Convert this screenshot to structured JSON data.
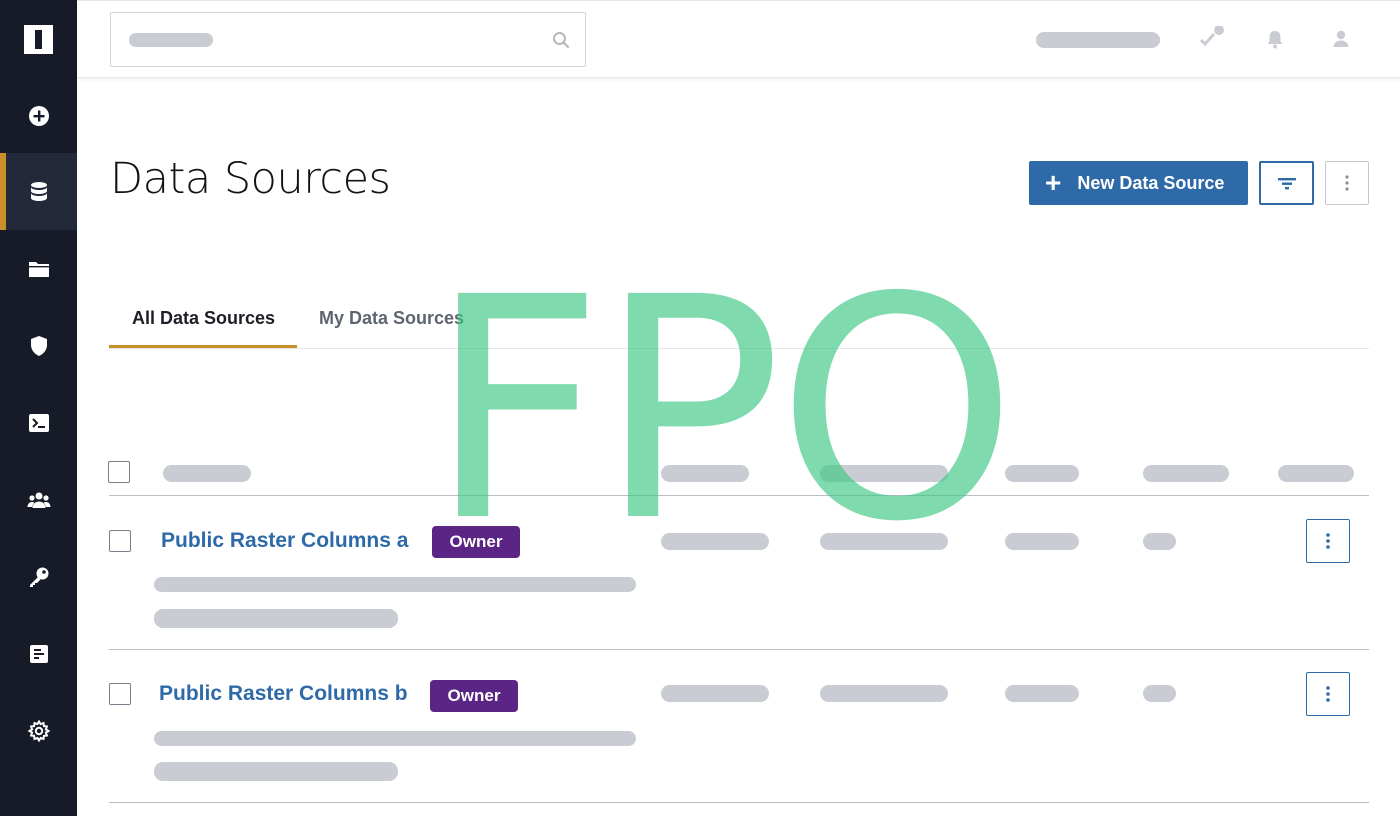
{
  "sidebar": {
    "logo": "app-logo",
    "items": [
      {
        "icon": "plus-circle-icon",
        "active": false
      },
      {
        "icon": "database-icon",
        "active": true
      },
      {
        "icon": "folder-icon",
        "active": false
      },
      {
        "icon": "shield-icon",
        "active": false
      },
      {
        "icon": "terminal-icon",
        "active": false
      },
      {
        "icon": "users-icon",
        "active": false
      },
      {
        "icon": "key-icon",
        "active": false
      },
      {
        "icon": "report-icon",
        "active": false
      },
      {
        "icon": "gear-icon",
        "active": false
      }
    ]
  },
  "header": {
    "search": {
      "placeholder": "",
      "icon": "search-icon"
    },
    "icons": [
      "tasks-icon",
      "bell-icon",
      "user-icon"
    ]
  },
  "page": {
    "title": "Data Sources",
    "new_button_label": "New Data Source",
    "filter_icon": "filter-icon",
    "more_icon": "vertical-dots-icon"
  },
  "tabs": [
    {
      "label": "All Data Sources",
      "active": true
    },
    {
      "label": "My Data Sources",
      "active": false
    }
  ],
  "rows": [
    {
      "title": "Public Raster Columns a",
      "badge": "Owner"
    },
    {
      "title": "Public Raster Columns b",
      "badge": "Owner"
    }
  ],
  "overlay": {
    "text": "FPO"
  },
  "colors": {
    "sidebar_bg": "#161b27",
    "accent": "#c98f2a",
    "primary": "#2f6aa8",
    "badge": "#5a2584",
    "fpo": "#3cc882"
  }
}
